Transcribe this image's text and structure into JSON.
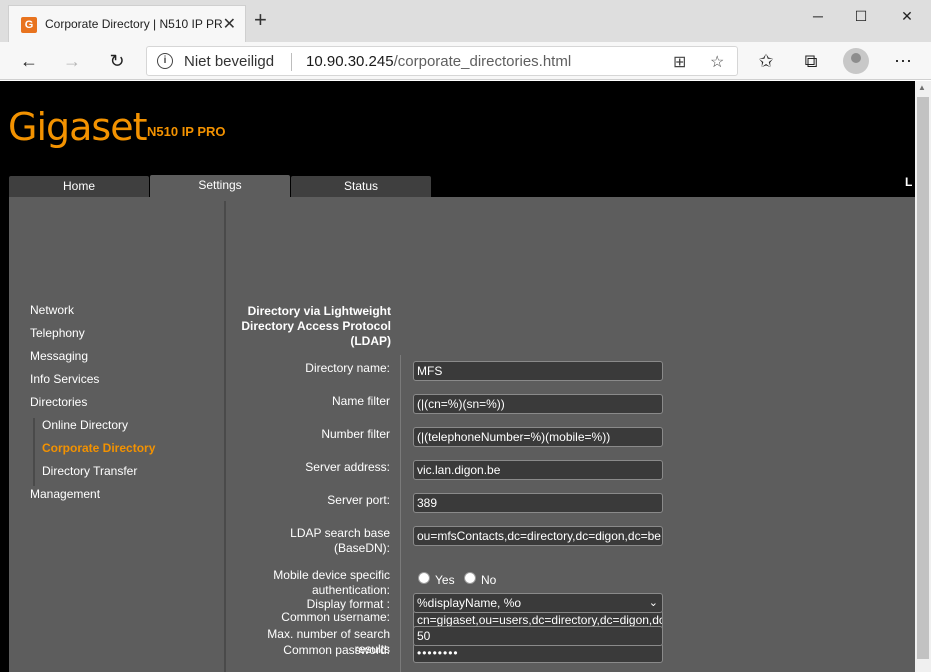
{
  "browser": {
    "tab_title": "Corporate Directory | N510 IP PR",
    "favicon_letter": "G",
    "address": {
      "security_label": "Niet beveiligd",
      "host": "10.90.30.245",
      "path": "/corporate_directories.html"
    }
  },
  "header": {
    "brand": "Gigaset",
    "model": "N510 IP PRO",
    "corner_text": "L",
    "brand_color": "#f39200"
  },
  "top_tabs": [
    {
      "label": "Home"
    },
    {
      "label": "Settings"
    },
    {
      "label": "Status"
    }
  ],
  "sidebar": {
    "items": [
      {
        "label": "Network"
      },
      {
        "label": "Telephony"
      },
      {
        "label": "Messaging"
      },
      {
        "label": "Info Services"
      },
      {
        "label": "Directories"
      },
      {
        "label": "Management"
      }
    ],
    "sub_items": [
      {
        "label": "Online Directory"
      },
      {
        "label": "Corporate Directory"
      },
      {
        "label": "Directory Transfer"
      }
    ]
  },
  "form": {
    "heading": "Directory via Lightweight Directory Access Protocol (LDAP)",
    "directory_name": {
      "label": "Directory name:",
      "value": "MFS"
    },
    "name_filter": {
      "label": "Name filter",
      "value": "(|(cn=%)(sn=%))"
    },
    "number_filter": {
      "label": "Number filter",
      "value": "(|(telephoneNumber=%)(mobile=%))"
    },
    "server_address": {
      "label": "Server address:",
      "value": "vic.lan.digon.be"
    },
    "server_port": {
      "label": "Server port:",
      "value": "389"
    },
    "search_base": {
      "label": "LDAP search base (BaseDN):",
      "value": "ou=mfsContacts,dc=directory,dc=digon,dc=be"
    },
    "mobile_auth": {
      "label": "Mobile device specific authentication:",
      "yes": "Yes",
      "no": "No"
    },
    "common_username": {
      "label": "Common username:",
      "value": "cn=gigaset,ou=users,dc=directory,dc=digon,dc=be"
    },
    "common_password": {
      "label": "Common password:",
      "value": "••••••••"
    },
    "display_format": {
      "label": "Display format :",
      "value": "%displayName, %o"
    },
    "max_results": {
      "label": "Max. number of search results",
      "value": "50"
    }
  }
}
